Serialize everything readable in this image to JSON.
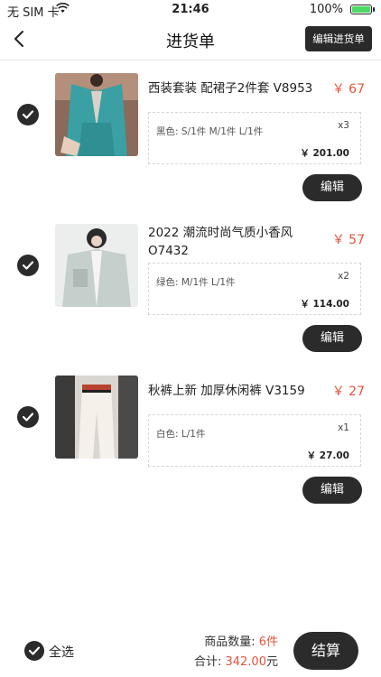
{
  "status_bar": {
    "carrier": "无 SIM 卡",
    "time": "21:46",
    "battery": "100%"
  },
  "nav": {
    "title": "进货单",
    "edit_label": "编辑进货单",
    "back_icon": "chevron-left-icon"
  },
  "items": [
    {
      "name": "西装套装 配裙子2件套  V8953",
      "price": "￥ 67",
      "spec": "黑色: S/1件 M/1件 L/1件",
      "qty": "x3",
      "subtotal": "￥ 201.00",
      "edit_label": "编辑",
      "image_colors": [
        "#5aa8a5",
        "#2f8f93",
        "#b3907a"
      ]
    },
    {
      "name": "2022 潮流时尚气质小香风 O7432",
      "price": "￥ 57",
      "spec": "绿色: M/1件 L/1件",
      "qty": "x2",
      "subtotal": "￥ 114.00",
      "edit_label": "编辑",
      "image_colors": [
        "#dfe3e0",
        "#b7c2be",
        "#2a2a2a"
      ]
    },
    {
      "name": "秋裤上新 加厚休闲裤  V3159",
      "price": "￥ 27",
      "spec": "白色: L/1件",
      "qty": "x1",
      "subtotal": "￥ 27.00",
      "edit_label": "编辑",
      "image_colors": [
        "#f2eee6",
        "#3b3b3b",
        "#b9422f"
      ]
    }
  ],
  "footer": {
    "select_all_label": "全选",
    "count_prefix": "商品数量: ",
    "count_value": "6件",
    "total_prefix": "合计: ",
    "total_value": "342.00",
    "total_suffix": "元",
    "checkout_label": "结算"
  },
  "colors": {
    "accent": "#e2553b",
    "dark": "#2b2b2b"
  }
}
